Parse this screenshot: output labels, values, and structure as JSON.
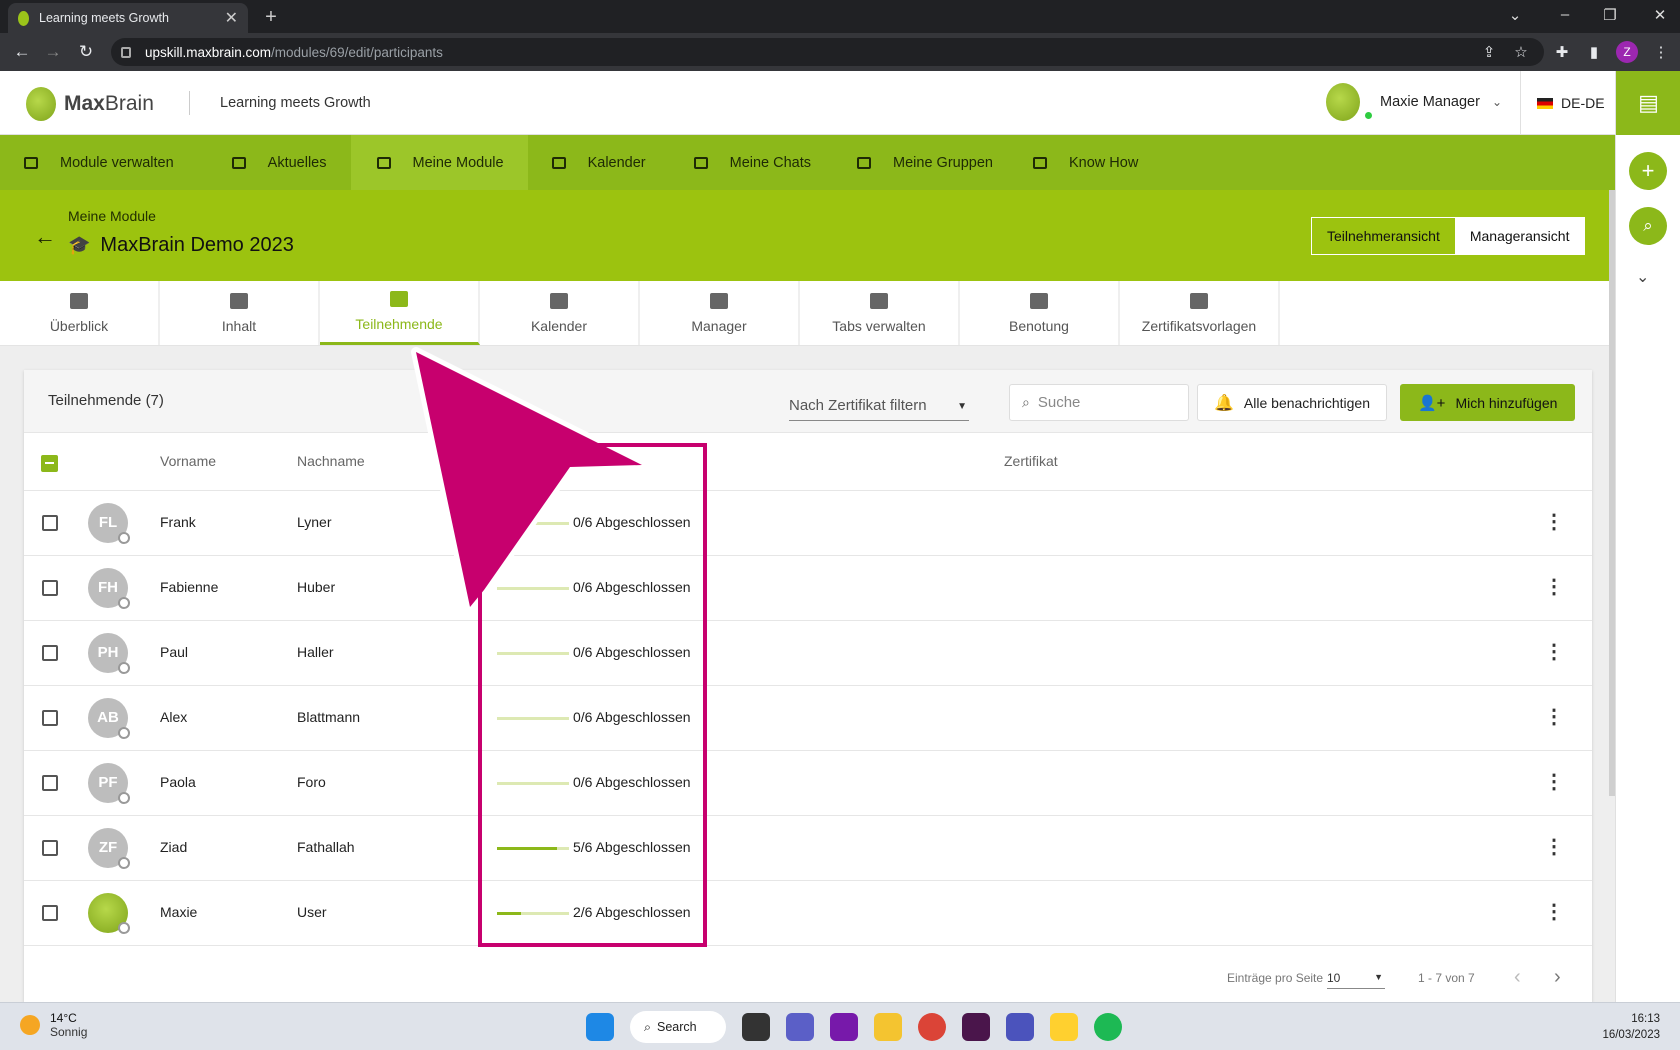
{
  "browser": {
    "tab_title": "Learning meets Growth",
    "url_host": "upskill.maxbrain.com",
    "url_path": "/modules/69/edit/participants",
    "profile_initial": "Z"
  },
  "header": {
    "brand_max": "Max",
    "brand_brain": "Brain",
    "tagline": "Learning meets Growth",
    "user_name": "Maxie Manager",
    "language": "DE-DE"
  },
  "main_nav": [
    {
      "label": "Module verwalten",
      "icon": "module-icon"
    },
    {
      "label": "Aktuelles",
      "icon": "news-icon"
    },
    {
      "label": "Meine Module",
      "icon": "graduation-cap-icon"
    },
    {
      "label": "Kalender",
      "icon": "calendar-icon"
    },
    {
      "label": "Meine Chats",
      "icon": "chat-icon"
    },
    {
      "label": "Meine Gruppen",
      "icon": "group-icon"
    },
    {
      "label": "Know How",
      "icon": "book-icon"
    }
  ],
  "module": {
    "breadcrumb": "Meine Module",
    "title": "MaxBrain Demo 2023",
    "view_participant": "Teilnehmeransicht",
    "view_manager": "Manageransicht"
  },
  "subtabs": [
    {
      "label": "Überblick",
      "icon": "dashboard-icon"
    },
    {
      "label": "Inhalt",
      "icon": "folder-icon"
    },
    {
      "label": "Teilnehmende",
      "icon": "people-icon"
    },
    {
      "label": "Kalender",
      "icon": "calendar-icon"
    },
    {
      "label": "Manager",
      "icon": "manager-icon"
    },
    {
      "label": "Tabs verwalten",
      "icon": "window-icon"
    },
    {
      "label": "Benotung",
      "icon": "grade-icon"
    },
    {
      "label": "Zertifikatsvorlagen",
      "icon": "certificate-settings-icon"
    }
  ],
  "participants": {
    "title": "Teilnehmende (7)",
    "filter_placeholder": "Nach Zertifikat filtern",
    "search_placeholder": "Suche",
    "notify_all": "Alle benachrichtigen",
    "add_me": "Mich hinzufügen",
    "columns": {
      "first_name": "Vorname",
      "last_name": "Nachname",
      "certificate": "Zertifikat"
    },
    "rows": [
      {
        "initials": "FL",
        "first": "Frank",
        "last": "Lyner",
        "progress": 0,
        "progress_text": "0/6 Abgeschlossen"
      },
      {
        "initials": "FH",
        "first": "Fabienne",
        "last": "Huber",
        "progress": 0,
        "progress_text": "0/6 Abgeschlossen"
      },
      {
        "initials": "PH",
        "first": "Paul",
        "last": "Haller",
        "progress": 0,
        "progress_text": "0/6 Abgeschlossen"
      },
      {
        "initials": "AB",
        "first": "Alex",
        "last": "Blattmann",
        "progress": 0,
        "progress_text": "0/6 Abgeschlossen"
      },
      {
        "initials": "PF",
        "first": "Paola",
        "last": "Foro",
        "progress": 0,
        "progress_text": "0/6 Abgeschlossen"
      },
      {
        "initials": "ZF",
        "first": "Ziad",
        "last": "Fathallah",
        "progress": 0.833,
        "progress_text": "5/6 Abgeschlossen"
      },
      {
        "initials": "",
        "first": "Maxie",
        "last": "User",
        "progress": 0.333,
        "progress_text": "2/6 Abgeschlossen"
      }
    ],
    "pager": {
      "per_page_label": "Einträge pro Seite",
      "per_page": "10",
      "range": "1 - 7 von 7"
    }
  },
  "taskbar": {
    "temperature": "14°C",
    "weather": "Sonnig",
    "search": "Search",
    "time": "16:13",
    "date": "16/03/2023"
  },
  "colors": {
    "brand_green": "#8cb81a",
    "annotation_magenta": "#c7006e"
  }
}
